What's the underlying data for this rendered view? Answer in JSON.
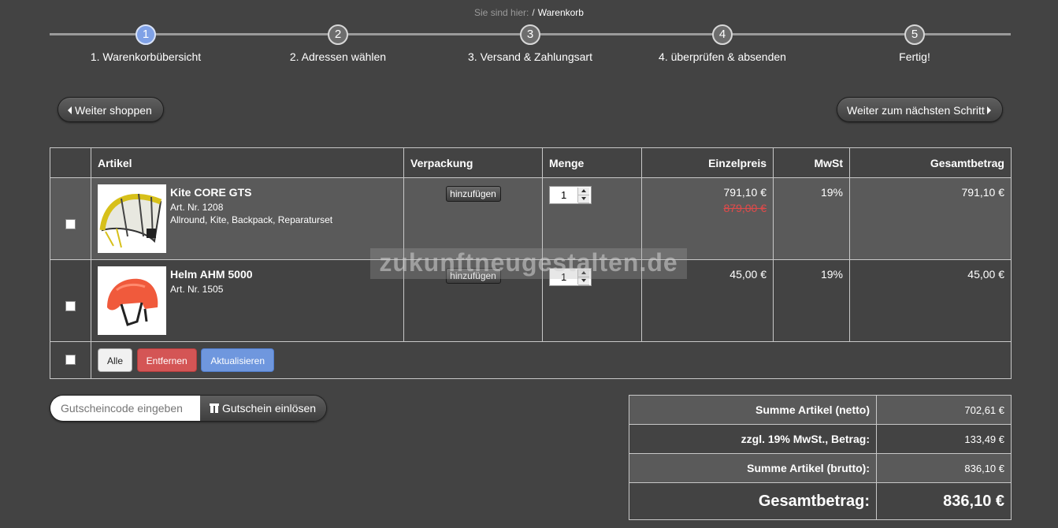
{
  "breadcrumb": {
    "prefix": "Sie sind hier:",
    "separator": "/",
    "current": "Warenkorb"
  },
  "steps": [
    {
      "number": "1",
      "label": "1. Warenkorbübersicht",
      "active": true
    },
    {
      "number": "2",
      "label": "2. Adressen wählen"
    },
    {
      "number": "3",
      "label": "3. Versand & Zahlungsart"
    },
    {
      "number": "4",
      "label": "4. überprüfen & absenden"
    },
    {
      "number": "5",
      "label": "Fertig!"
    }
  ],
  "nav": {
    "back_label": "Weiter shoppen",
    "next_label": "Weiter zum nächsten Schritt"
  },
  "table": {
    "headers": {
      "article": "Artikel",
      "packaging": "Verpackung",
      "quantity": "Menge",
      "unit_price": "Einzelpreis",
      "vat": "MwSt",
      "total": "Gesamtbetrag"
    },
    "packaging_button": "hinzufügen",
    "items": [
      {
        "name": "Kite CORE GTS",
        "art_nr": "Art. Nr. 1208",
        "tags": "Allround, Kite, Backpack, Reparaturset",
        "quantity": "1",
        "unit_price": "791,10 €",
        "old_price": "879,00 €",
        "vat": "19%",
        "total": "791,10 €"
      },
      {
        "name": "Helm AHM 5000",
        "art_nr": "Art. Nr. 1505",
        "quantity": "1",
        "unit_price": "45,00 €",
        "vat": "19%",
        "total": "45,00 €"
      }
    ],
    "actions": {
      "all": "Alle",
      "remove": "Entfernen",
      "update": "Aktualisieren"
    }
  },
  "coupon": {
    "placeholder": "Gutscheincode eingeben",
    "button": "Gutschein einlösen"
  },
  "totals": {
    "net_label": "Summe Artikel (netto)",
    "net_value": "702,61 €",
    "vat_label": "zzgl. 19% MwSt., Betrag:",
    "vat_value": "133,49 €",
    "gross_label": "Summe Artikel (brutto):",
    "gross_value": "836,10 €",
    "grand_label": "Gesamtbetrag:",
    "grand_value": "836,10 €"
  },
  "watermark": "zukunftneugestalten.de"
}
